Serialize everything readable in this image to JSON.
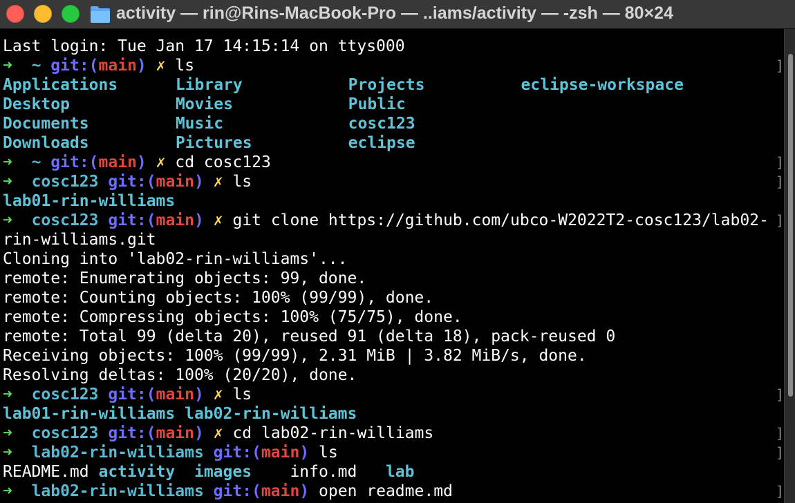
{
  "window": {
    "title": "activity — rin@Rins-MacBook-Pro — ..iams/activity — -zsh — 80×24",
    "icon": "folder-icon",
    "colors": {
      "background": "#000000",
      "prompt_arrow": "#5fd75f",
      "directory": "#5ab8d0",
      "git_label": "#6d6dff",
      "branch": "#e0463f",
      "dirty_marker": "#ffd75f"
    }
  },
  "terminal": {
    "lines": [
      {
        "kind": "text",
        "text": "Last login: Tue Jan 17 14:15:14 on ttys000"
      },
      {
        "kind": "prompt",
        "arrow": "➜",
        "dir": "~",
        "git": "git:(",
        "branch": "main",
        "git_end": ")",
        "x": "✗",
        "cmd": "ls"
      },
      {
        "kind": "cols",
        "cells": [
          "Applications",
          "Library",
          "Projects",
          "eclipse-workspace"
        ]
      },
      {
        "kind": "cols",
        "cells": [
          "Desktop",
          "Movies",
          "Public",
          ""
        ]
      },
      {
        "kind": "cols",
        "cells": [
          "Documents",
          "Music",
          "cosc123",
          ""
        ]
      },
      {
        "kind": "cols",
        "cells": [
          "Downloads",
          "Pictures",
          "eclipse",
          ""
        ]
      },
      {
        "kind": "prompt",
        "arrow": "➜",
        "dir": "~",
        "git": "git:(",
        "branch": "main",
        "git_end": ")",
        "x": "✗",
        "cmd": "cd cosc123"
      },
      {
        "kind": "prompt",
        "arrow": "➜",
        "dir": "cosc123",
        "git": "git:(",
        "branch": "main",
        "git_end": ")",
        "x": "✗",
        "cmd": "ls"
      },
      {
        "kind": "dirtext",
        "text": "lab01-rin-williams"
      },
      {
        "kind": "prompt",
        "arrow": "➜",
        "dir": "cosc123",
        "git": "git:(",
        "branch": "main",
        "git_end": ")",
        "x": "✗",
        "cmd": "git clone https://github.com/ubco-W2022T2-cosc123/lab02-"
      },
      {
        "kind": "text",
        "text": "rin-williams.git"
      },
      {
        "kind": "text",
        "text": "Cloning into 'lab02-rin-williams'..."
      },
      {
        "kind": "text",
        "text": "remote: Enumerating objects: 99, done."
      },
      {
        "kind": "text",
        "text": "remote: Counting objects: 100% (99/99), done."
      },
      {
        "kind": "text",
        "text": "remote: Compressing objects: 100% (75/75), done."
      },
      {
        "kind": "text",
        "text": "remote: Total 99 (delta 20), reused 91 (delta 18), pack-reused 0"
      },
      {
        "kind": "text",
        "text": "Receiving objects: 100% (99/99), 2.31 MiB | 3.82 MiB/s, done."
      },
      {
        "kind": "text",
        "text": "Resolving deltas: 100% (20/20), done."
      },
      {
        "kind": "prompt",
        "arrow": "➜",
        "dir": "cosc123",
        "git": "git:(",
        "branch": "main",
        "git_end": ")",
        "x": "✗",
        "cmd": "ls"
      },
      {
        "kind": "dirtext",
        "text": "lab01-rin-williams lab02-rin-williams"
      },
      {
        "kind": "prompt",
        "arrow": "➜",
        "dir": "cosc123",
        "git": "git:(",
        "branch": "main",
        "git_end": ")",
        "x": "✗",
        "cmd": "cd lab02-rin-williams"
      },
      {
        "kind": "prompt",
        "arrow": "➜",
        "dir": "lab02-rin-williams",
        "git": "git:(",
        "branch": "main",
        "git_end": ")",
        "x": "",
        "cmd": "ls"
      },
      {
        "kind": "mixed",
        "parts": [
          {
            "t": "README.md ",
            "c": "plain"
          },
          {
            "t": "activity",
            "c": "dir"
          },
          {
            "t": "  ",
            "c": "plain"
          },
          {
            "t": "images",
            "c": "dir"
          },
          {
            "t": "    info.md   ",
            "c": "plain"
          },
          {
            "t": "lab",
            "c": "dir"
          }
        ]
      },
      {
        "kind": "prompt",
        "arrow": "➜",
        "dir": "lab02-rin-williams",
        "git": "git:(",
        "branch": "main",
        "git_end": ")",
        "x": "",
        "cmd": "open readme.md"
      }
    ],
    "markers": [
      "]",
      "]",
      "]",
      "]",
      "]",
      "]",
      "]",
      "]",
      "]",
      "]",
      "]",
      "]",
      "]",
      "]",
      "]",
      "]",
      "]",
      "]",
      "]",
      "]",
      "]",
      "]",
      "]",
      "]"
    ]
  }
}
